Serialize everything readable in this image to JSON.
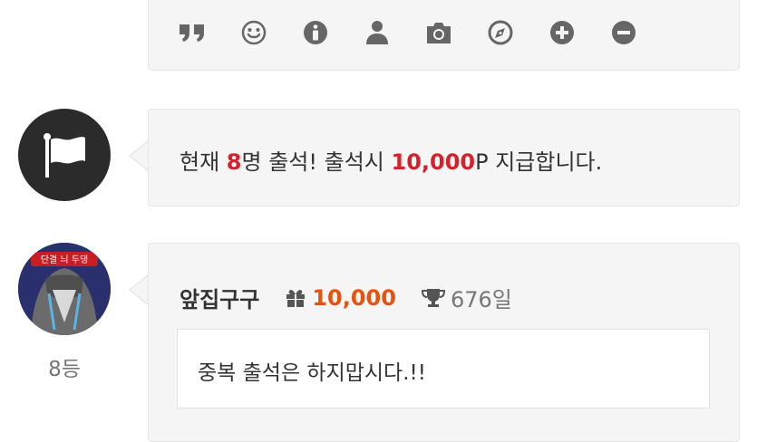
{
  "toolbar": {
    "icons": [
      "quote-icon",
      "smile-icon",
      "info-icon",
      "user-icon",
      "camera-icon",
      "compass-icon",
      "plus-circle-icon",
      "minus-circle-icon"
    ],
    "icon_color": "#666666"
  },
  "notice": {
    "prefix": "현재 ",
    "count": "8",
    "mid": "명 출석! 출석시 ",
    "points": "10,000",
    "suffix": "P 지급합니다.",
    "highlight_color": "#d6202b"
  },
  "comment": {
    "nickname": "앞집구구",
    "points": "10,000",
    "points_color": "#e4540f",
    "days": "676일",
    "message": "중복 출석은 하지맙시다.!!",
    "rank": "8등"
  },
  "avatar_banner_text": "단결 늬 두댕"
}
